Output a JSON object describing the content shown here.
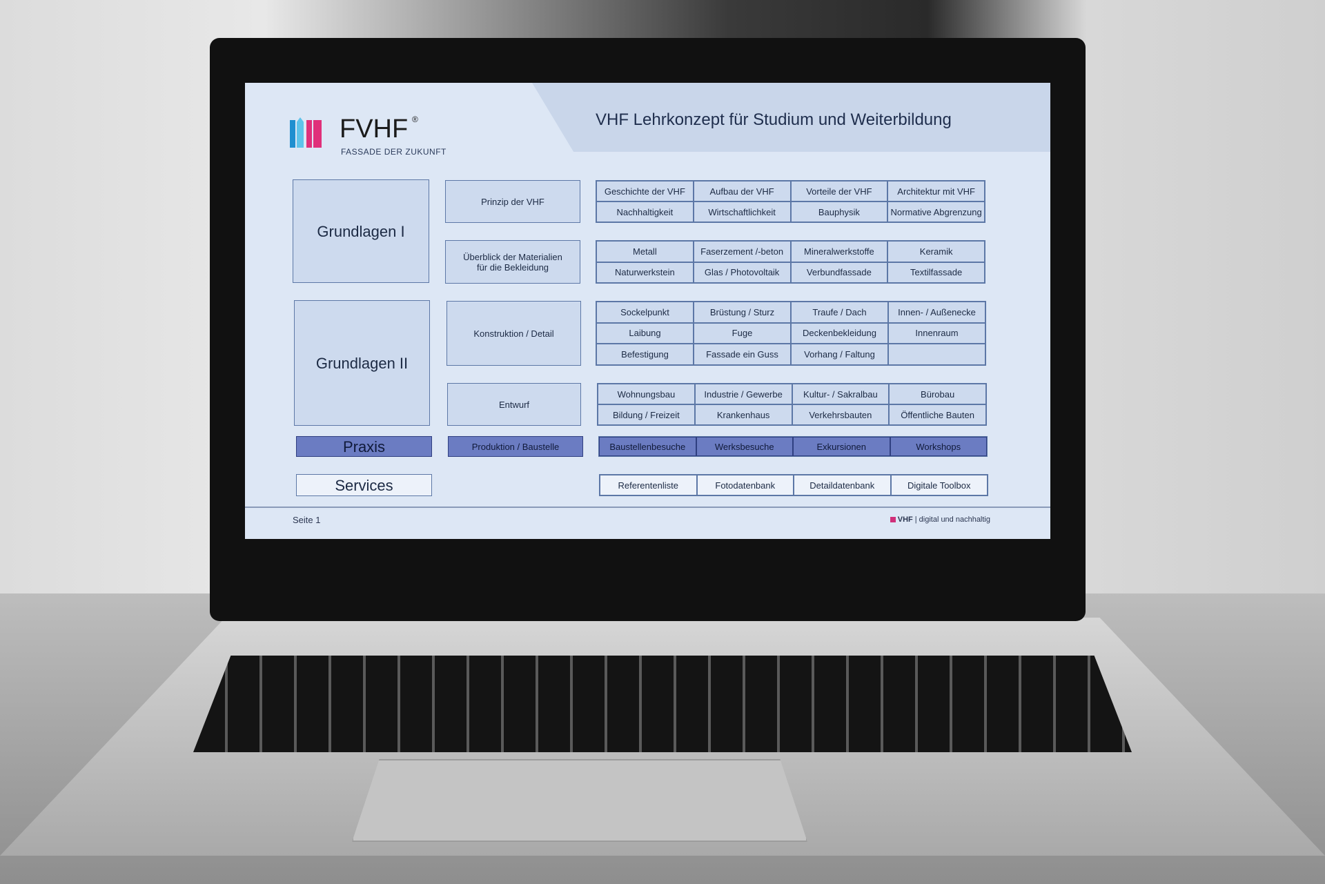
{
  "slide": {
    "logo": {
      "name": "FVHF",
      "registered": "®",
      "tagline": "FASSADE DER ZUKUNFT",
      "colors": [
        "#1f8fd0",
        "#e0307a"
      ]
    },
    "title": "VHF Lehrkonzept für Studium und Weiterbildung",
    "column1": [
      "Grundlagen I",
      "Grundlagen II",
      "Praxis",
      "Services"
    ],
    "column2": [
      "Prinzip der VHF",
      "Überblick der Materialien für die Bekleidung",
      "Konstruktion / Detail",
      "Entwurf",
      "Produktion / Baustelle"
    ],
    "grids": [
      [
        "Geschichte der VHF",
        "Aufbau der VHF",
        "Vorteile der VHF",
        "Architektur mit VHF",
        "Nachhaltigkeit",
        "Wirtschaftlichkeit",
        "Bauphysik",
        "Normative Abgrenzung"
      ],
      [
        "Metall",
        "Faserzement /-beton",
        "Mineralwerkstoffe",
        "Keramik",
        "Naturwerkstein",
        "Glas / Photovoltaik",
        "Verbundfassade",
        "Textilfassade"
      ],
      [
        "Sockelpunkt",
        "Brüstung / Sturz",
        "Traufe / Dach",
        "Innen- / Außenecke",
        "Laibung",
        "Fuge",
        "Deckenbekleidung",
        "Innenraum",
        "Befestigung",
        "Fassade ein Guss",
        "Vorhang / Faltung",
        ""
      ],
      [
        "Wohnungsbau",
        "Industrie / Gewerbe",
        "Kultur- / Sakralbau",
        "Bürobau",
        "Bildung / Freizeit",
        "Krankenhaus",
        "Verkehrsbauten",
        "Öffentliche Bauten"
      ],
      [
        "Baustellenbesuche",
        "Werksbesuche",
        "Exkursionen",
        "Workshops"
      ],
      [
        "Referentenliste",
        "Fotodatenbank",
        "Detaildatenbank",
        "Digitale Toolbox"
      ]
    ],
    "footer": {
      "page": "Seite 1",
      "brand": "VHF",
      "separator": "|",
      "slogan": "digital und nachhaltig",
      "accent": "#d0307a"
    },
    "colors": {
      "background": "#dde7f5",
      "box": "#cddaee",
      "border": "#5c77a6",
      "praxis": "#6b7cc2"
    }
  }
}
